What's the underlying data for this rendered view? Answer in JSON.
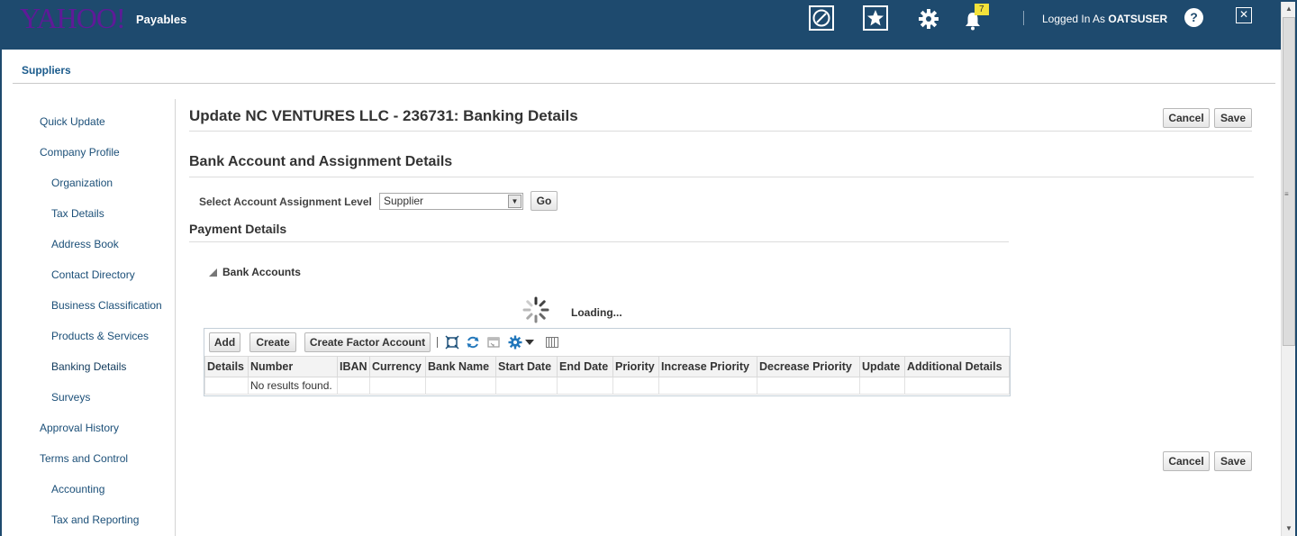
{
  "header": {
    "logo": "YAHOO!",
    "app_name": "Payables",
    "notification_count": "7",
    "logged_prefix": "Logged In As ",
    "username": "OATSUSER",
    "help": "?",
    "icons": [
      "navigator-icon",
      "favorites-star-icon",
      "settings-gear-icon",
      "notifications-bell-icon",
      "help-icon",
      "close-window-icon"
    ]
  },
  "tabs": [
    {
      "label": "Suppliers"
    }
  ],
  "nav": {
    "items": [
      {
        "label": "Quick Update"
      },
      {
        "label": "Company Profile"
      },
      {
        "label": "Organization"
      },
      {
        "label": "Tax Details"
      },
      {
        "label": "Address Book"
      },
      {
        "label": "Contact Directory"
      },
      {
        "label": "Business Classification"
      },
      {
        "label": "Products & Services"
      },
      {
        "label": "Banking Details"
      },
      {
        "label": "Surveys"
      },
      {
        "label": "Approval History"
      },
      {
        "label": "Terms and Control"
      },
      {
        "label": "Accounting"
      },
      {
        "label": "Tax and Reporting"
      }
    ]
  },
  "page": {
    "title": "Update NC VENTURES LLC - 236731: Banking Details",
    "cancel_label": "Cancel",
    "save_label": "Save",
    "subtitle": "Bank Account and Assignment Details",
    "assign_label": "Select Account Assignment Level",
    "assign_value": "Supplier",
    "go_label": "Go",
    "payment_title": "Payment Details",
    "bank_accounts_label": "Bank Accounts",
    "loading_text": "Loading..."
  },
  "table": {
    "toolbar": {
      "add_label": "Add",
      "create_label": "Create",
      "factor_label": "Create Factor Account"
    },
    "columns": [
      "Details",
      "Number",
      "IBAN",
      "Currency",
      "Bank Name",
      "Start Date",
      "End Date",
      "Priority",
      "Increase Priority",
      "Decrease Priority",
      "Update",
      "Additional Details"
    ],
    "empty_text": "No results found."
  },
  "colors": {
    "header_bg": "#1e4a6e",
    "link": "#1b4f78",
    "logo": "#5f1a98",
    "badge": "#f4e23a"
  }
}
